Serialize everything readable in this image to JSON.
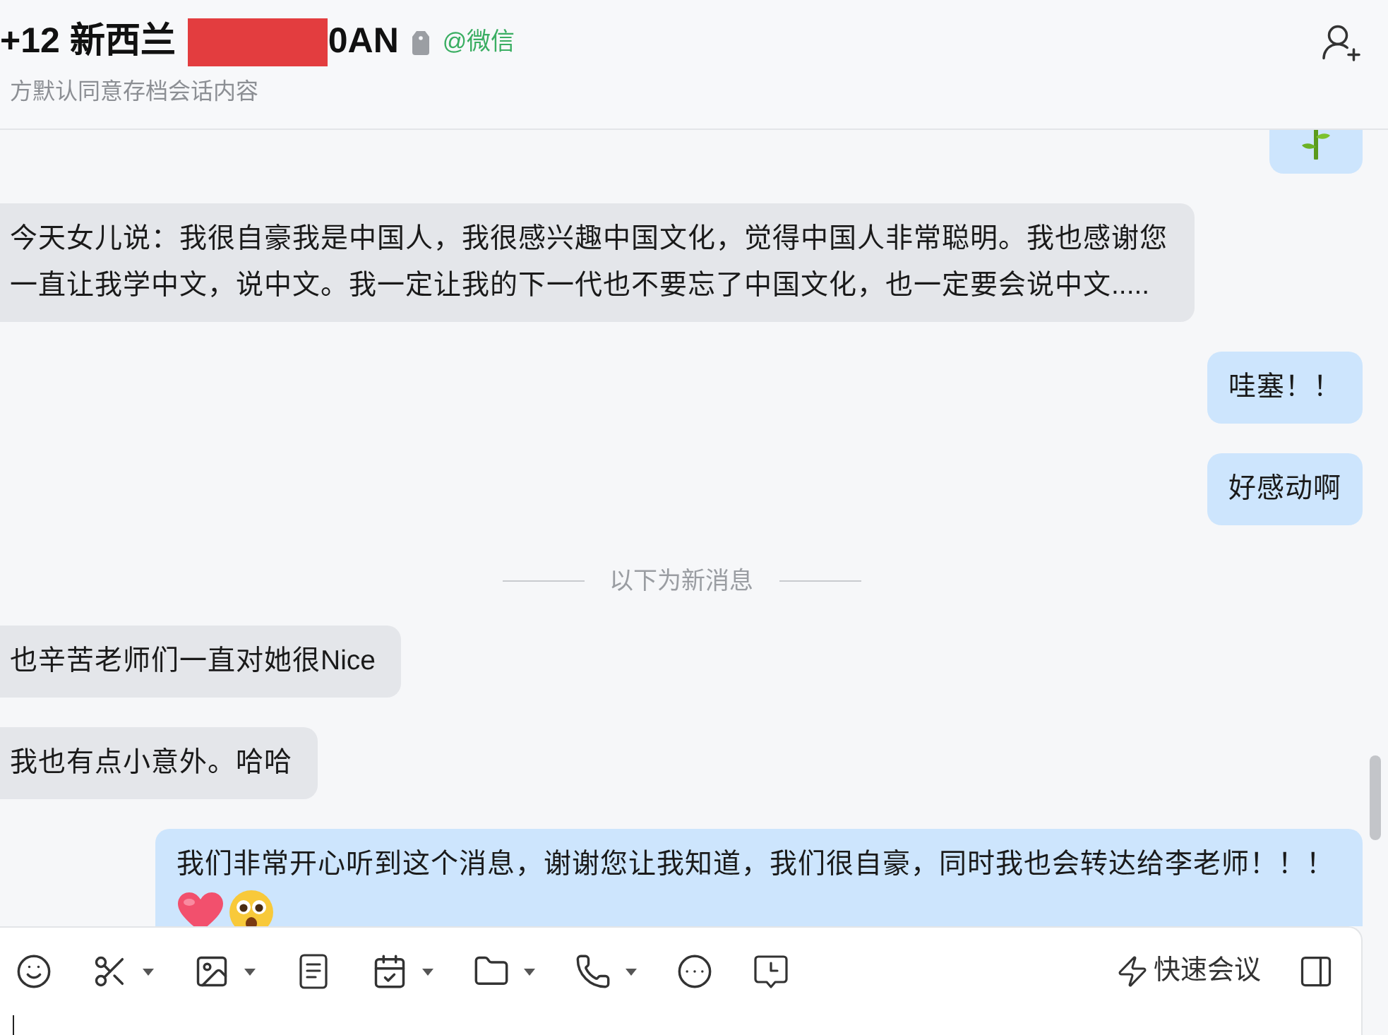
{
  "header": {
    "title": "+12 新西兰",
    "title_end": "0AN",
    "account_tag": "@微信",
    "subtitle": "方默认同意存档会话内容"
  },
  "messages": [
    {
      "kind": "sticker",
      "outgoing": true
    },
    {
      "kind": "text",
      "outgoing": false,
      "text": "今天女儿说：我很自豪我是中国人，我很感兴趣中国文化，觉得中国人非常聪明。我也感谢您一直让我学中文，说中文。我一定让我的下一代也不要忘了中国文化，也一定要会说中文....."
    },
    {
      "kind": "text",
      "outgoing": true,
      "text": "哇塞！！"
    },
    {
      "kind": "text",
      "outgoing": true,
      "text": "好感动啊"
    },
    {
      "kind": "divider",
      "text": "以下为新消息"
    },
    {
      "kind": "text",
      "outgoing": false,
      "text": "也辛苦老师们一直对她很Nice"
    },
    {
      "kind": "text",
      "outgoing": false,
      "text": "我也有点小意外。哈哈"
    },
    {
      "kind": "text_emoji",
      "outgoing": true,
      "text": "我们非常开心听到这个消息，谢谢您让我知道，我们很自豪，同时我也会转达给李老师！！！"
    }
  ],
  "composer": {
    "quick_meeting": "快速会议"
  }
}
